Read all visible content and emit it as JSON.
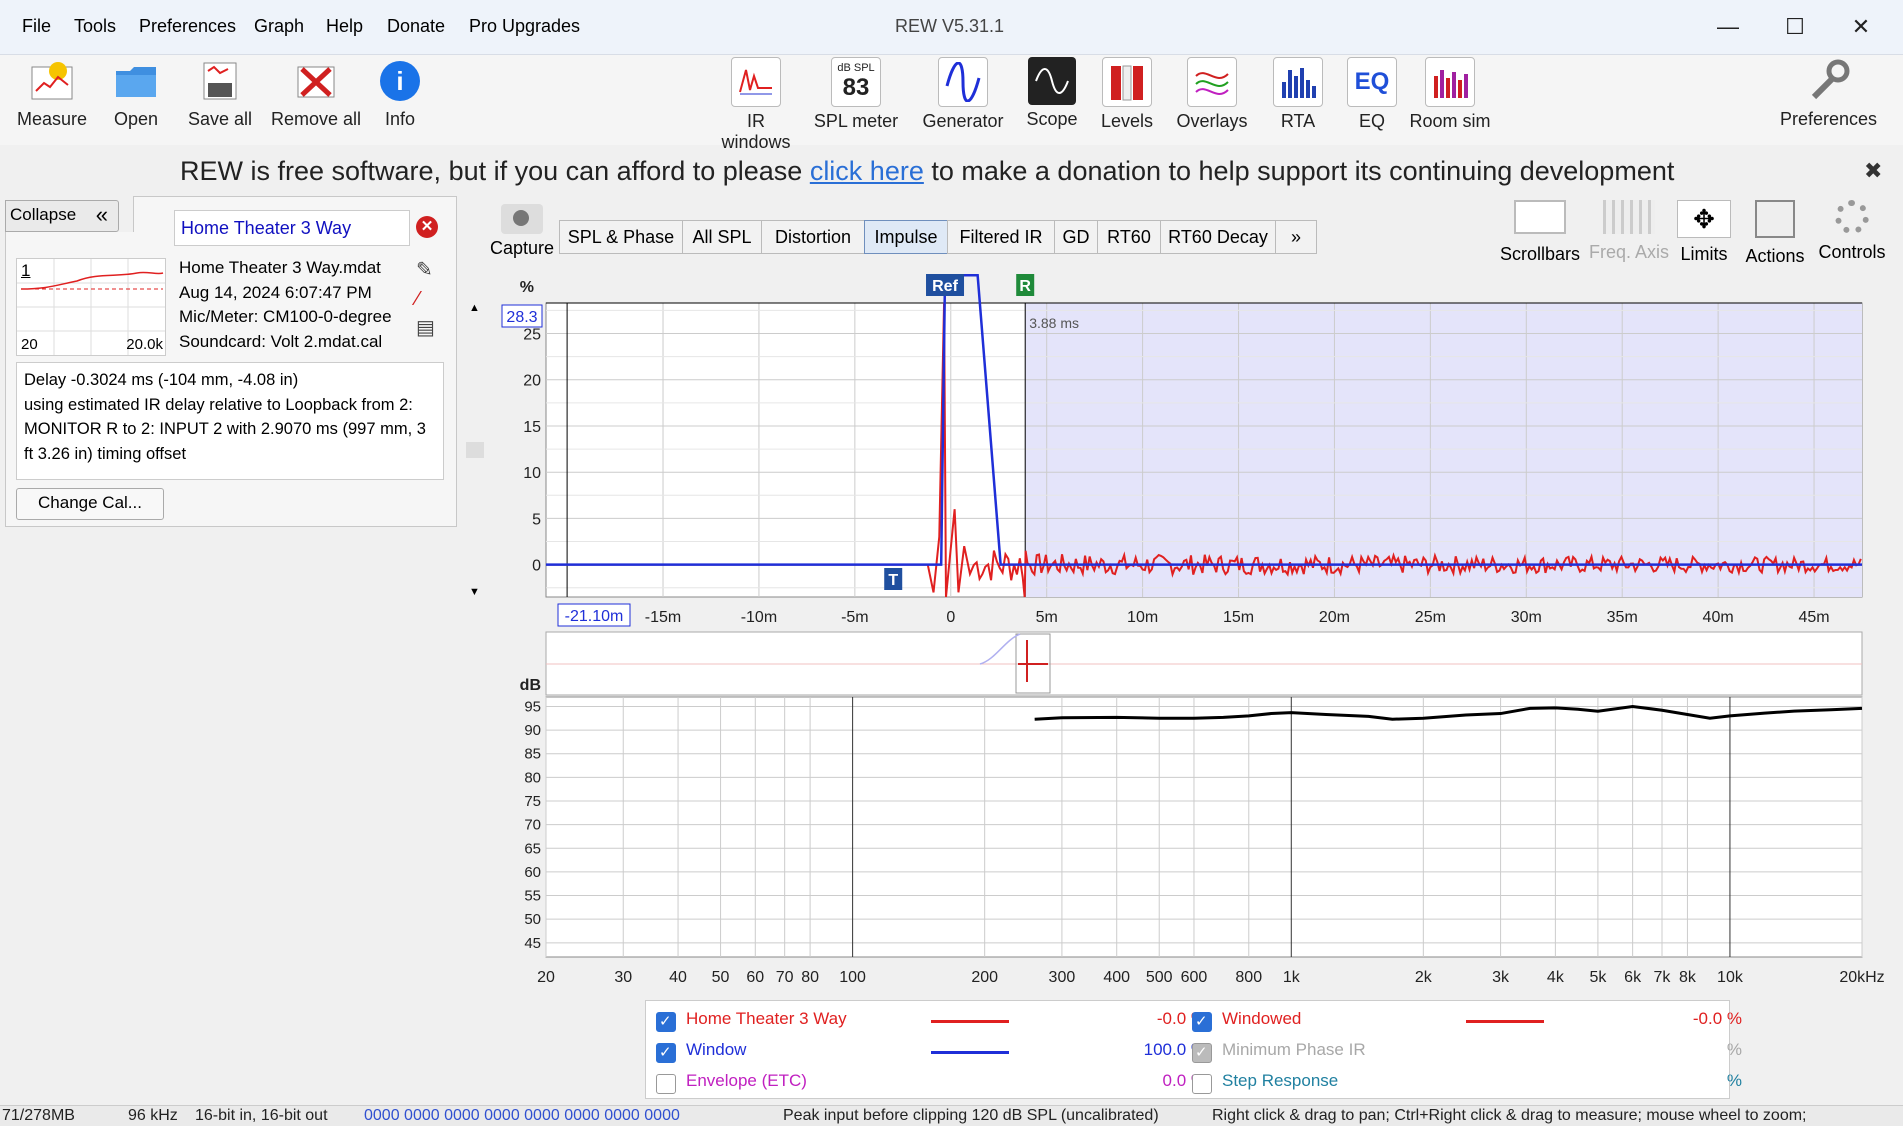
{
  "window": {
    "title": "REW V5.31.1",
    "minimize": "—",
    "maximize": "☐",
    "close": "✕"
  },
  "menu": [
    "File",
    "Tools",
    "Preferences",
    "Graph",
    "Help",
    "Donate",
    "Pro Upgrades"
  ],
  "toolbar": {
    "left": [
      "Measure",
      "Open",
      "Save all",
      "Remove all",
      "Info"
    ],
    "center": [
      "IR windows",
      "SPL meter",
      "Generator",
      "Scope",
      "Levels",
      "Overlays",
      "RTA",
      "EQ",
      "Room sim"
    ],
    "spl_meter_top": "dB SPL",
    "spl_meter_value": "83",
    "preferences": "Preferences"
  },
  "banner": {
    "before": "REW is free software, but if you can afford to please ",
    "link": "click here",
    "after": " to make a donation to help support its continuing development",
    "close": "✖"
  },
  "left_panel": {
    "collapse": "Collapse",
    "collapse_icon": "«",
    "measurement_name": "Home Theater 3 Way",
    "thumb_index": "1",
    "thumb_min": "20",
    "thumb_max": "20.0k",
    "file": "Home Theater 3 Way.mdat",
    "date": "Aug 14, 2024 6:07:47 PM",
    "mic": "Mic/Meter: CM100-0-degree",
    "soundcard": "Soundcard: Volt 2.mdat.cal",
    "delay_text": "Delay -0.3024 ms (-104 mm, -4.08 in)\nusing estimated IR delay relative to Loopback from 2: MONITOR R to 2: INPUT 2 with 2.9070 ms (997 mm, 3 ft 3.26 in) timing offset",
    "change_cal": "Change Cal..."
  },
  "graph": {
    "capture": "Capture",
    "tabs": [
      "SPL & Phase",
      "All SPL",
      "Distortion",
      "Impulse",
      "Filtered IR",
      "GD",
      "RT60",
      "RT60 Decay",
      "»"
    ],
    "active_tab": "Impulse",
    "right_tools": [
      "Scrollbars",
      "Freq. Axis",
      "Limits",
      "Actions",
      "Controls"
    ],
    "colors": {
      "measurement": "#e02020",
      "window": "#1f2fd8",
      "window_region": "#e4e4fa"
    }
  },
  "chart_data": [
    {
      "type": "line",
      "ylabel": "%",
      "top_value_box": "28.3",
      "x_start_box": "-21.10m",
      "x_ticks": [
        "-15m",
        "-10m",
        "-5m",
        "0",
        "5m",
        "10m",
        "15m",
        "20m",
        "25m",
        "30m",
        "35m",
        "40m",
        "45m"
      ],
      "x_tick_values_ms": [
        -15,
        -10,
        -5,
        0,
        5,
        10,
        15,
        20,
        25,
        30,
        35,
        40,
        45
      ],
      "y_ticks": [
        "0",
        "5",
        "10",
        "15",
        "20",
        "25"
      ],
      "y_tick_values": [
        0,
        5,
        10,
        15,
        20,
        25
      ],
      "xlim_ms": [
        -21.1,
        47.5
      ],
      "ylim": [
        -3.5,
        28.3
      ],
      "markers": {
        "ref": "Ref",
        "r": "R",
        "t": "T",
        "r_label": "3.88 ms"
      },
      "marker_positions_ms": {
        "ref": -0.3,
        "r": 3.88,
        "t": -3.0
      },
      "series": [
        {
          "name": "Home Theater 3 Way",
          "color": "#e02020",
          "shape": "impulse_peak_at_ms",
          "peak_ms": -0.3,
          "peak_value": 28.3,
          "noise_amplitude": 1.2
        },
        {
          "name": "Window",
          "color": "#1f2fd8",
          "shape": "window_flat_top",
          "rise_ms": -0.3,
          "fall_start_ms": 1.4,
          "fall_end_ms": 3.88
        }
      ]
    },
    {
      "type": "line",
      "ylabel": "dB",
      "x_ticks": [
        "20",
        "30",
        "40",
        "50",
        "60",
        "70",
        "80",
        "100",
        "200",
        "300",
        "400",
        "500",
        "600",
        "800",
        "1k",
        "2k",
        "3k",
        "4k",
        "5k",
        "6k",
        "7k",
        "8k",
        "10k",
        "20kHz"
      ],
      "x_tick_values_hz": [
        20,
        30,
        40,
        50,
        60,
        70,
        80,
        100,
        200,
        300,
        400,
        500,
        600,
        800,
        1000,
        2000,
        3000,
        4000,
        5000,
        6000,
        7000,
        8000,
        10000,
        20000
      ],
      "y_ticks": [
        "95",
        "90",
        "85",
        "80",
        "75",
        "70",
        "65",
        "60",
        "55",
        "50",
        "45"
      ],
      "y_tick_values": [
        95,
        90,
        85,
        80,
        75,
        70,
        65,
        60,
        55,
        50,
        45
      ],
      "ylim": [
        42,
        97
      ],
      "series": [
        {
          "name": "Home Theater 3 Way",
          "color": "#000000",
          "x": [
            260,
            300,
            400,
            500,
            600,
            700,
            800,
            900,
            1000,
            1200,
            1500,
            1700,
            2000,
            2500,
            3000,
            3500,
            4000,
            4500,
            5000,
            6000,
            7000,
            8000,
            9000,
            10000,
            12000,
            14000,
            17000,
            20000
          ],
          "y": [
            92.3,
            92.6,
            92.7,
            92.5,
            92.5,
            92.7,
            93.0,
            93.5,
            93.7,
            93.3,
            92.9,
            92.3,
            92.5,
            93.2,
            93.5,
            94.6,
            94.7,
            94.4,
            94.0,
            95.0,
            94.2,
            93.3,
            92.5,
            93.0,
            93.6,
            94.0,
            94.3,
            94.6
          ]
        }
      ]
    }
  ],
  "legend": [
    {
      "label": "Home Theater 3 Way",
      "value": "-0.0 %",
      "color": "#e02020",
      "checked": true,
      "line": true
    },
    {
      "label": "Windowed",
      "value": "-0.0 %",
      "color": "#e02020",
      "checked": true,
      "line": true
    },
    {
      "label": "Window",
      "value": "100.0 %",
      "color": "#1f2fd8",
      "checked": true,
      "line": true
    },
    {
      "label": "Minimum Phase IR",
      "value": "%",
      "color": "#a8a8a8",
      "checked": true,
      "line": false
    },
    {
      "label": "Envelope (ETC)",
      "value": "0.0 %",
      "color": "#c020c0",
      "checked": false,
      "line": false
    },
    {
      "label": "Step Response",
      "value": "%",
      "color": "#2080a0",
      "checked": false,
      "line": false
    }
  ],
  "status": {
    "memory": "71/278MB",
    "rate": "96 kHz",
    "bits": "16-bit in, 16-bit out",
    "hex": "0000 0000  0000 0000  0000 0000  0000 0000",
    "peak": "Peak input before clipping 120 dB SPL (uncalibrated)",
    "hint": "Right click & drag to pan; Ctrl+Right click & drag to measure; mouse wheel to zoom;"
  }
}
